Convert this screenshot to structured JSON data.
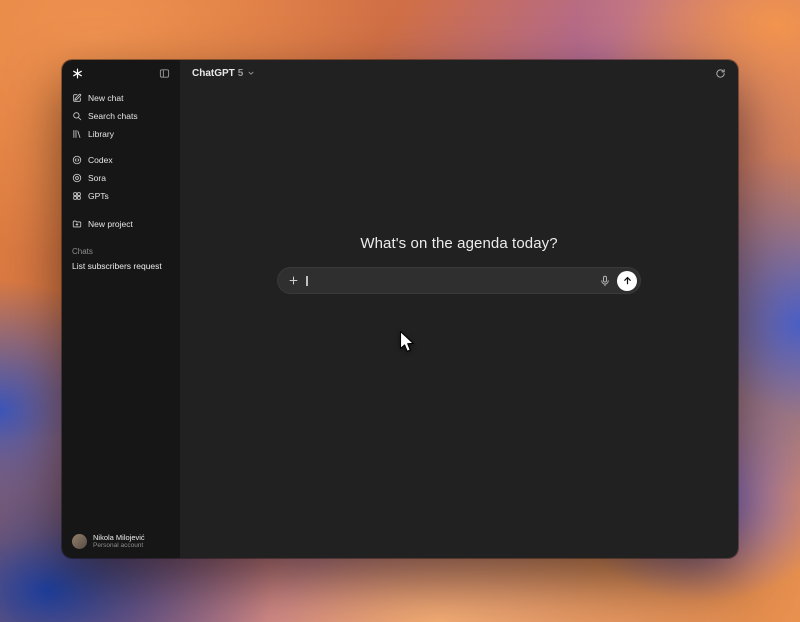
{
  "titlebar": {
    "model_name": "ChatGPT",
    "model_version": "5"
  },
  "sidebar": {
    "nav": [
      {
        "label": "New chat",
        "icon": "new-chat-icon"
      },
      {
        "label": "Search chats",
        "icon": "search-icon"
      },
      {
        "label": "Library",
        "icon": "library-icon"
      }
    ],
    "apps": [
      {
        "label": "Codex",
        "icon": "codex-icon"
      },
      {
        "label": "Sora",
        "icon": "sora-icon"
      },
      {
        "label": "GPTs",
        "icon": "gpts-icon"
      }
    ],
    "new_project_label": "New project",
    "chats_header": "Chats",
    "chat_items": [
      {
        "title": "List subscribers request"
      }
    ],
    "account": {
      "name": "Nikola Milojević",
      "plan": "Personal account"
    }
  },
  "main": {
    "greeting": "What's on the agenda today?",
    "composer": {
      "value": "",
      "plus_icon": "plus",
      "mic_icon": "microphone",
      "send_icon": "arrow-up"
    }
  },
  "colors": {
    "sidebar_bg": "#161616",
    "main_bg": "#212121",
    "composer_bg": "#2f2f2f",
    "text_primary": "#ececec",
    "text_secondary": "#8e8e8e",
    "send_button_bg": "#ffffff"
  }
}
